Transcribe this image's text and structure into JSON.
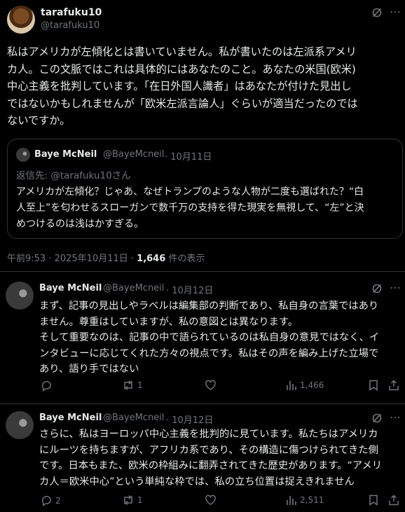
{
  "main": {
    "author": {
      "name": "tarafuku10",
      "handle": "@tarafuku10"
    },
    "lines": [
      "私はアメリカが左傾化とは書いていません。私が書いたのは左派系アメリ",
      "カ人。この文脈ではこれは具体的にはあなたのこと。あなたの米国(欧米)",
      "中心主義を批判しています。「在日外国人識者」はあなたが付けた見出し",
      "ではないかもしれませんが「欧米左派言論人」ぐらいが適当だったのでは",
      "ないですか。"
    ],
    "quote": {
      "name": "Baye McNeil",
      "handle": "@BayeMcneil",
      "date": "· 10月11日",
      "reply_to": "返信先: @tarafuku10さん",
      "lines": [
        "アメリカが左傾化？じゃあ、なぜトランプのような人物が二度も選ばれた？“白",
        "人至上”を匂わせるスローガンで数千万の支持を得た現実を無視して、“左”と決",
        "めつけるのは浅はかすぎる。"
      ]
    },
    "timestamp": "午前9:53 · 2025年10月11日 · ",
    "views_count": "1,646",
    "views_label": " 件の表示"
  },
  "replies": [
    {
      "name": "Baye McNeil",
      "handle": "@BayeMcneil",
      "date": "· 10月12日",
      "lines": [
        "まず、記事の見出しやラベルは編集部の判断であり、私自身の言葉ではあり",
        "ません。尊重はしていますが、私の意図とは異なります。",
        "そして重要なのは、記事の中で語られているのは私自身の意見ではなく、イ",
        "ンタビューに応じてくれた方々の視点です。私はその声を編み上げた立場で",
        "あり、語り手ではない"
      ],
      "reply_count": "",
      "repost_count": "1",
      "like_count": "",
      "view_count": "1,466"
    },
    {
      "name": "Baye McNeil",
      "handle": "@BayeMcneil",
      "date": "· 10月12日",
      "lines": [
        "さらに、私はヨーロッパ中心主義を批判的に見ています。私たちはアメリカ",
        "にルーツを持ちますが、アフリカ系であり、その構造に傷つけられてきた側",
        "です。日本もまた、欧米の枠組みに翻弄されてきた歴史があります。“アメリ",
        "カ人＝欧米中心”という単純な枠では、私の立ち位置は捉えきれません"
      ],
      "reply_count": "2",
      "repost_count": "1",
      "like_count": "",
      "view_count": "2,511"
    }
  ],
  "icons": [
    "grok-icon",
    "more-icon",
    "reply-icon",
    "repost-icon",
    "like-icon",
    "views-icon",
    "bookmark-icon",
    "share-icon"
  ]
}
